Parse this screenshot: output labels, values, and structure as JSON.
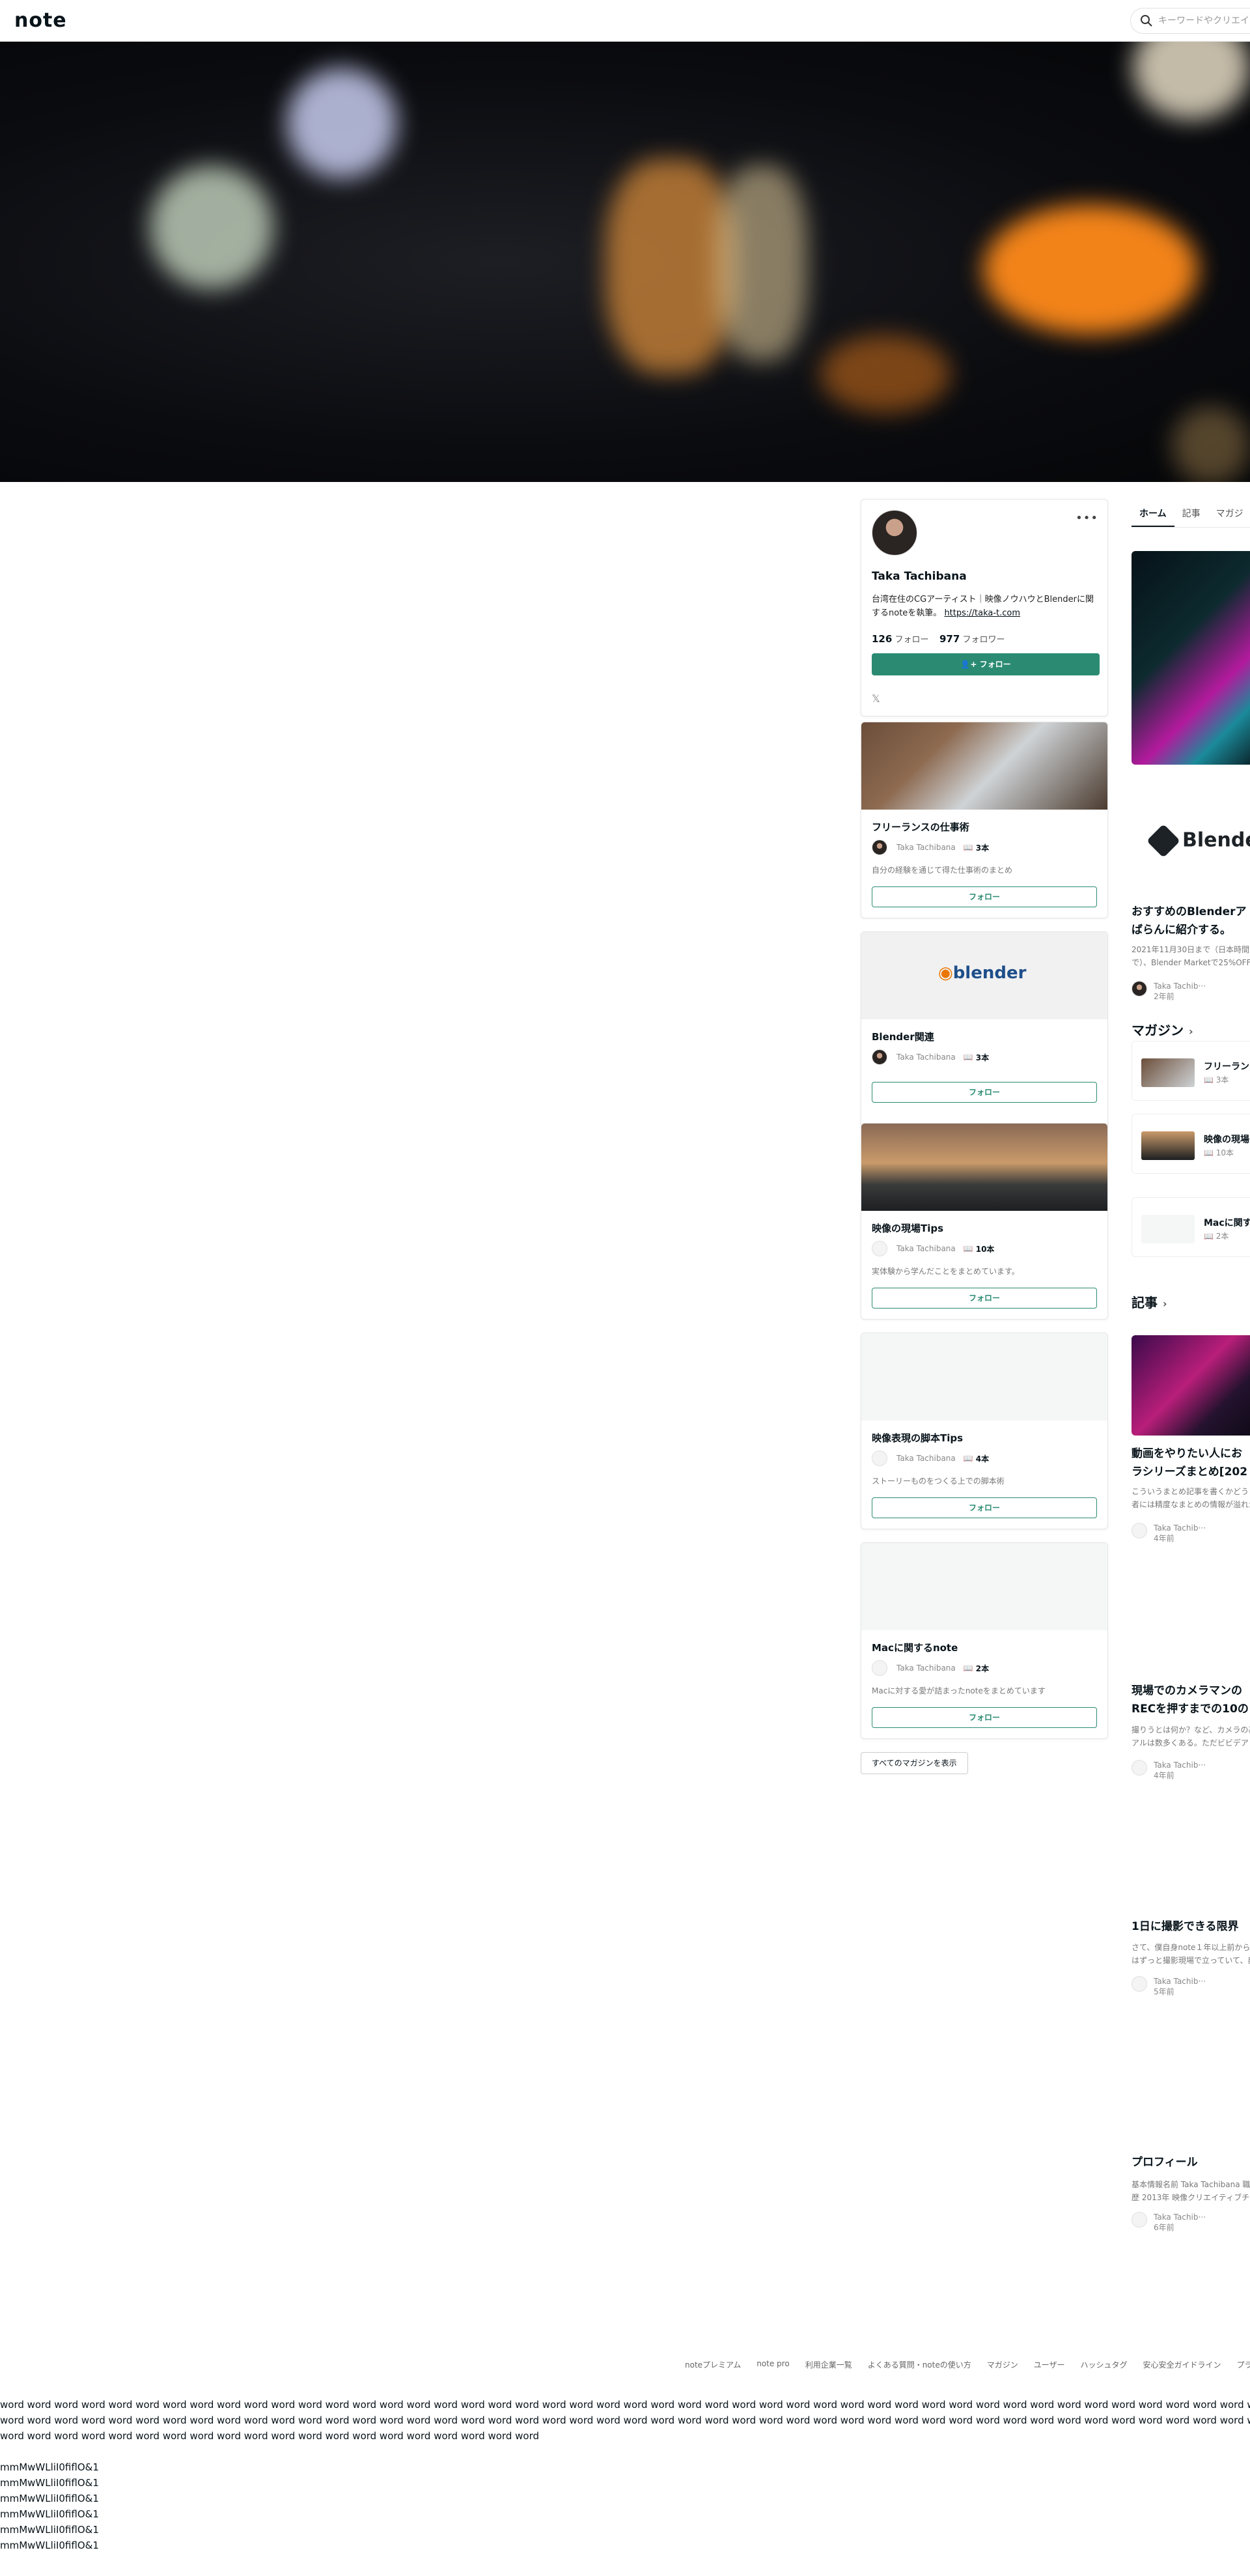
{
  "header": {
    "logo": "note",
    "search_placeholder": "キーワードやクリエイ"
  },
  "profile": {
    "name": "Taka Tachibana",
    "bio": "台湾在住のCGアーティスト｜映像ノウハウとBlenderに関するnoteを執筆。",
    "bio_link": "https://taka-t.com",
    "follow_count": "126",
    "follow_label": "フォロー",
    "follower_count": "977",
    "follower_label": "フォロワー",
    "follow_button": "フォロー",
    "x_icon": "x-logo-icon"
  },
  "magazines": [
    {
      "title": "フリーランスの仕事術",
      "author": "Taka Tachibana",
      "count": "3本",
      "desc": "自分の経験を通じて得た仕事術のまとめ",
      "follow": "フォロー"
    },
    {
      "title": "Blender関連",
      "author": "Taka Tachibana",
      "count": "3本",
      "desc": "",
      "follow": "フォロー",
      "thumb_text": "blender"
    },
    {
      "title": "映像の現場Tips",
      "author": "Taka Tachibana",
      "count": "10本",
      "desc": "実体験から学んだことをまとめています。",
      "follow": "フォロー"
    },
    {
      "title": "映像表現の脚本Tips",
      "author": "Taka Tachibana",
      "count": "4本",
      "desc": "ストーリーものをつくる上での脚本術",
      "follow": "フォロー"
    },
    {
      "title": "Macに関するnote",
      "author": "Taka Tachibana",
      "count": "2本",
      "desc": "Macに対する愛が詰まったnoteをまとめています",
      "follow": "フォロー"
    }
  ],
  "all_magazines_button": "すべてのマガジンを表示",
  "tabs": [
    "ホーム",
    "記事",
    "マガジ"
  ],
  "feature": {
    "blender_text": "Blender",
    "title_line1": "おすすめのBlenderア",
    "title_line2": "ばらんに紹介する。",
    "sub_line1": "2021年11月30日まで（日本時間で",
    "sub_line2": "で）、Blender Marketで25%OFF",
    "author": "Taka Tachib···",
    "time": "2年前"
  },
  "magazine_section": {
    "heading": "マガジン",
    "items": [
      {
        "title": "フリーラン",
        "count": "3本"
      },
      {
        "title": "映像の現場",
        "count": "10本"
      },
      {
        "title": "Macに関す",
        "count": "2本"
      }
    ]
  },
  "articles_section": {
    "heading": "記事",
    "items": [
      {
        "title_line1": "動画をやりたい人にお",
        "title_line2": "ラシリーズまとめ[202",
        "sub_line1": "こういうまとめ記事を書くかどう",
        "sub_line2": "者には精度なまとめの情報が溢れか",
        "author": "Taka Tachib···",
        "time": "4年前"
      },
      {
        "title_line1": "現場でのカメラマンの",
        "title_line2": "RECを押すまでの10の",
        "sub_line1": "撮りうとは何か？など、カメラの基",
        "sub_line2": "アルは数多くある。ただビビデア",
        "author": "Taka Tachib···",
        "time": "4年前"
      },
      {
        "title_line1": "1日に撮影できる限界",
        "title_line2": "",
        "sub_line1": "さて、僕自身note１年以上前から",
        "sub_line2": "はずっと撮影現場で立っていて、典",
        "author": "Taka Tachib···",
        "time": "5年前"
      },
      {
        "title_line1": "プロフィール",
        "title_line2": "",
        "sub_line1": "基本情報名前 Taka Tachibana 職業",
        "sub_line2": "歴 2013年 映像クリエイティブチー",
        "author": "Taka Tachib···",
        "time": "6年前"
      }
    ]
  },
  "footer": [
    "noteプレミアム",
    "note pro",
    "利用企業一覧",
    "よくある質問・noteの使い方",
    "マガジン",
    "ユーザー",
    "ハッシュタグ",
    "安心安全ガイドライン",
    "プラ"
  ],
  "filler": {
    "words_line1": "word word word word word word word word word word word word word word word word word word word word word word word word word word word word word word word word word word word word word word word word word word word word word word word word word word word word word word word word word word word word word word word word word word word word word word word word",
    "words_line2": "word word word word word word word word word word word word word word word word word word word word word word word word word word word word word word word word word word word word word word word word word word word word word word word word word word word word word word word word word word word word word word word word word word word word word word word word word",
    "words_line3": "word word word word word word word word word word word word word word word word word word word word",
    "glyphs": "mmMwWLliI0fiflO&1"
  }
}
